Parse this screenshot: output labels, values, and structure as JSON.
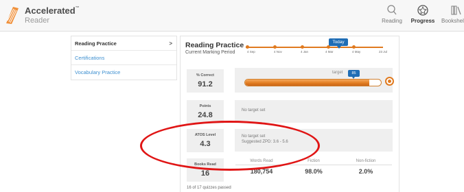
{
  "header": {
    "brand_name": "Accelerated",
    "brand_tm": "™",
    "brand_sub": "Reader",
    "nav": [
      {
        "label": "Reading",
        "icon": "search-icon"
      },
      {
        "label": "Progress",
        "icon": "progress-badge-icon",
        "active": true
      },
      {
        "label": "Bookshelf",
        "icon": "bookshelf-icon"
      }
    ]
  },
  "sidebar": {
    "items": [
      {
        "label": "Reading Practice",
        "active": true,
        "arrow": ">"
      },
      {
        "label": "Certifications"
      },
      {
        "label": "Vocabulary Practice"
      }
    ]
  },
  "panel": {
    "title": "Reading Practice",
    "subtitle": "Current Marking Period",
    "timeline": {
      "ticks": [
        "4 Sep",
        "4 Nov",
        "4 Jan",
        "4 Mar",
        "4 May",
        "23 Jul"
      ],
      "today_label": "Today"
    },
    "percent_correct": {
      "label": "% Correct",
      "value": "91.2",
      "target_label": "target",
      "target_value": "85",
      "fill": 0.912
    },
    "points": {
      "label": "Points",
      "value": "24.8",
      "note": "No target set"
    },
    "atos": {
      "label": "ATOS Level",
      "value": "4.3",
      "note": "No target set",
      "zpd": "Suggested ZPD: 3.6 - 5.6"
    },
    "books": {
      "label": "Books Read",
      "value": "16",
      "columns": [
        "Words Read",
        "Fiction",
        "Non-fiction"
      ],
      "values": [
        "180,754",
        "98.0%",
        "2.0%"
      ]
    },
    "quiz_footer": "16 of 17 quizzes passed"
  },
  "colors": {
    "accent": "#e07a1f",
    "brand_blue": "#1f6db5",
    "link_blue": "#3d8fd0",
    "highlight_red": "#e01515"
  }
}
